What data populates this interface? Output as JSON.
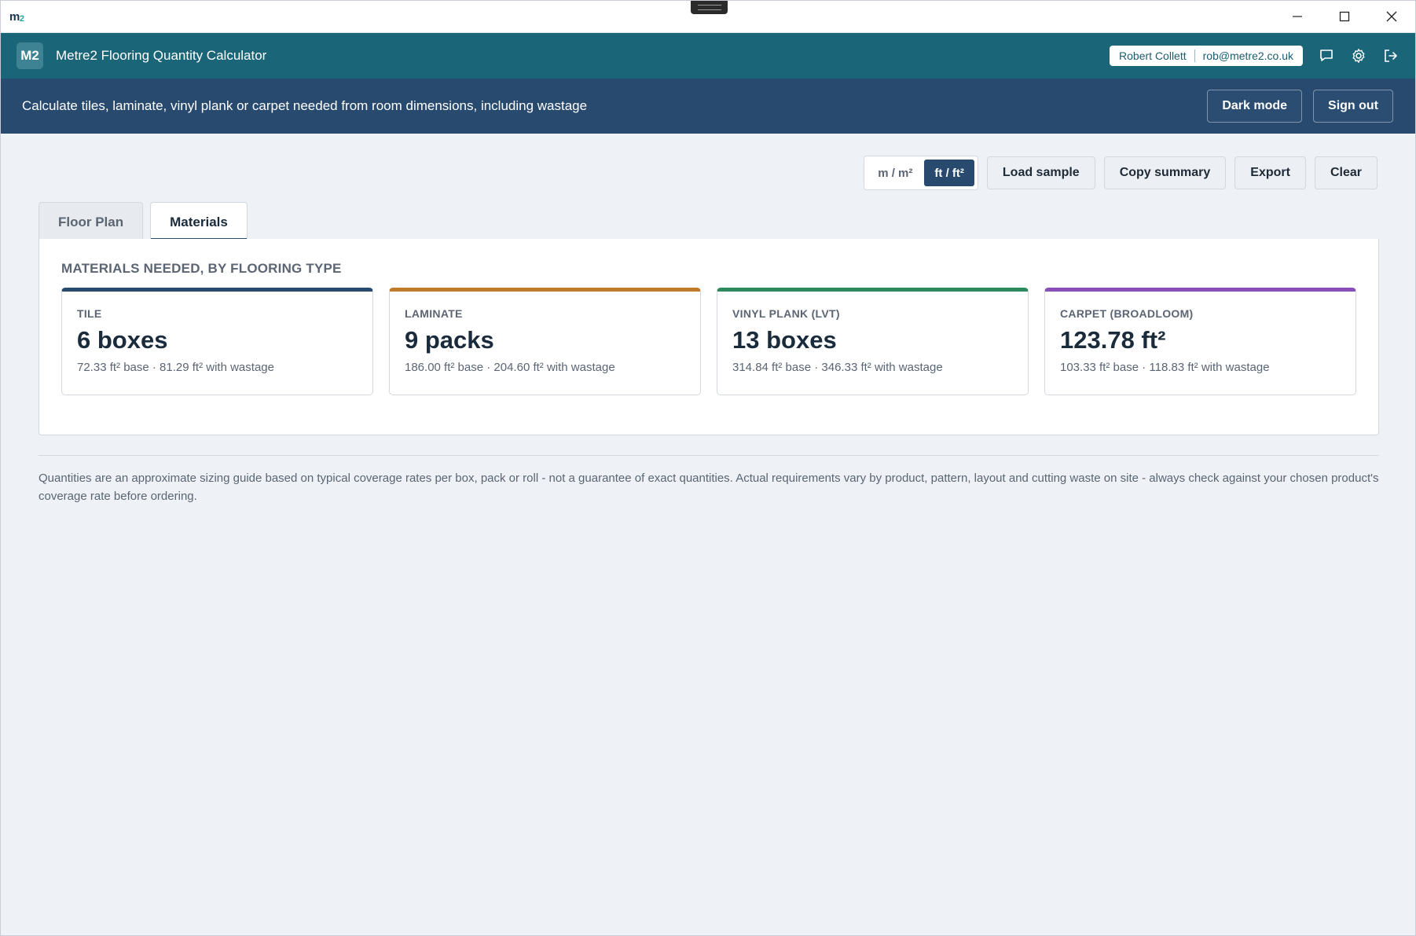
{
  "titlebar": {
    "logo": "m",
    "logo_sup": "2"
  },
  "header": {
    "badge": "M2",
    "title": "Metre2 Flooring Quantity Calculator",
    "user_name": "Robert Collett",
    "user_email": "rob@metre2.co.uk",
    "icons": [
      "chat-icon",
      "gear-icon",
      "logout-icon"
    ]
  },
  "subheader": {
    "description": "Calculate tiles, laminate, vinyl plank or carpet needed from room dimensions, including wastage",
    "dark_mode_label": "Dark mode",
    "sign_out_label": "Sign out"
  },
  "toolbar": {
    "units": [
      {
        "label": "m / m²",
        "active": false
      },
      {
        "label": "ft / ft²",
        "active": true
      }
    ],
    "load_sample": "Load sample",
    "copy_summary": "Copy summary",
    "export": "Export",
    "clear": "Clear"
  },
  "tabs": [
    {
      "label": "Floor Plan",
      "active": false
    },
    {
      "label": "Materials",
      "active": true
    }
  ],
  "materials": {
    "heading": "MATERIALS NEEDED, BY FLOORING TYPE",
    "cards": [
      {
        "label": "TILE",
        "value": "6 boxes",
        "detail": "72.33 ft² base · 81.29 ft² with wastage",
        "accent": "#284a6e"
      },
      {
        "label": "LAMINATE",
        "value": "9 packs",
        "detail": "186.00 ft² base · 204.60 ft² with wastage",
        "accent": "#c07a2c"
      },
      {
        "label": "VINYL PLANK (LVT)",
        "value": "13 boxes",
        "detail": "314.84 ft² base · 346.33 ft² with wastage",
        "accent": "#2e8a5e"
      },
      {
        "label": "CARPET (BROADLOOM)",
        "value": "123.78 ft²",
        "detail": "103.33 ft² base · 118.83 ft² with wastage",
        "accent": "#8a4fb6"
      }
    ]
  },
  "footnote": "Quantities are an approximate sizing guide based on typical coverage rates per box, pack or roll - not a guarantee of exact quantities. Actual requirements vary by product, pattern, layout and cutting waste on site - always check against your chosen product's coverage rate before ordering."
}
